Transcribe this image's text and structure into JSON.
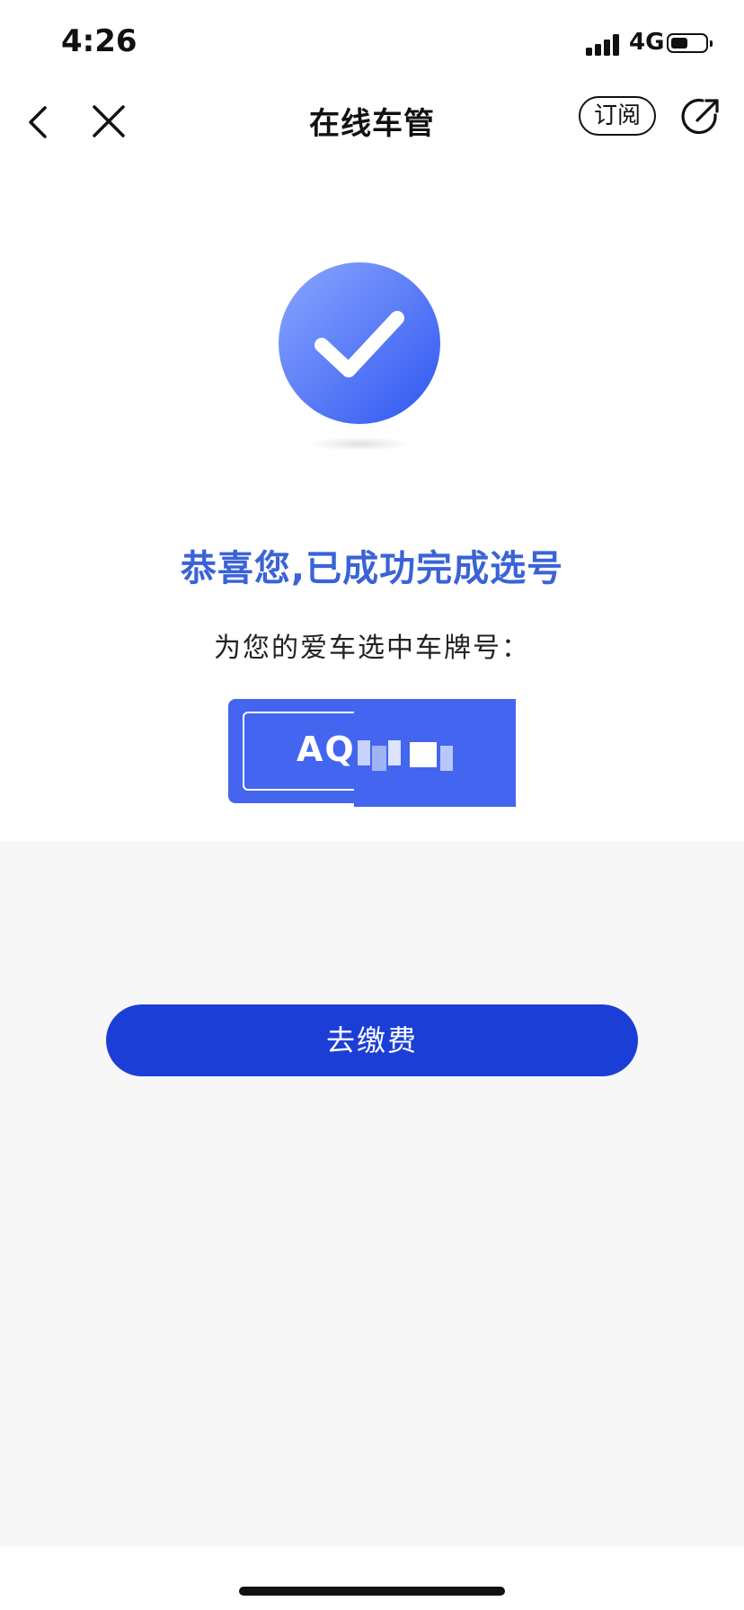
{
  "status_bar": {
    "time": "4:26",
    "network": "4G",
    "battery_level": 0.5
  },
  "nav": {
    "title": "在线车管",
    "subscribe_label": "订阅",
    "icons": [
      "back-icon",
      "close-icon",
      "share-icon"
    ]
  },
  "result": {
    "title": "恭喜您,已成功完成选号",
    "subtitle": "为您的爱车选中车牌号：",
    "plate_visible": "AQ"
  },
  "actions": {
    "pay_label": "去缴费"
  },
  "colors": {
    "accent": "#3a63d6",
    "plate": "#4365ef",
    "button": "#1b3fd6",
    "background": "#f7f7f7"
  }
}
